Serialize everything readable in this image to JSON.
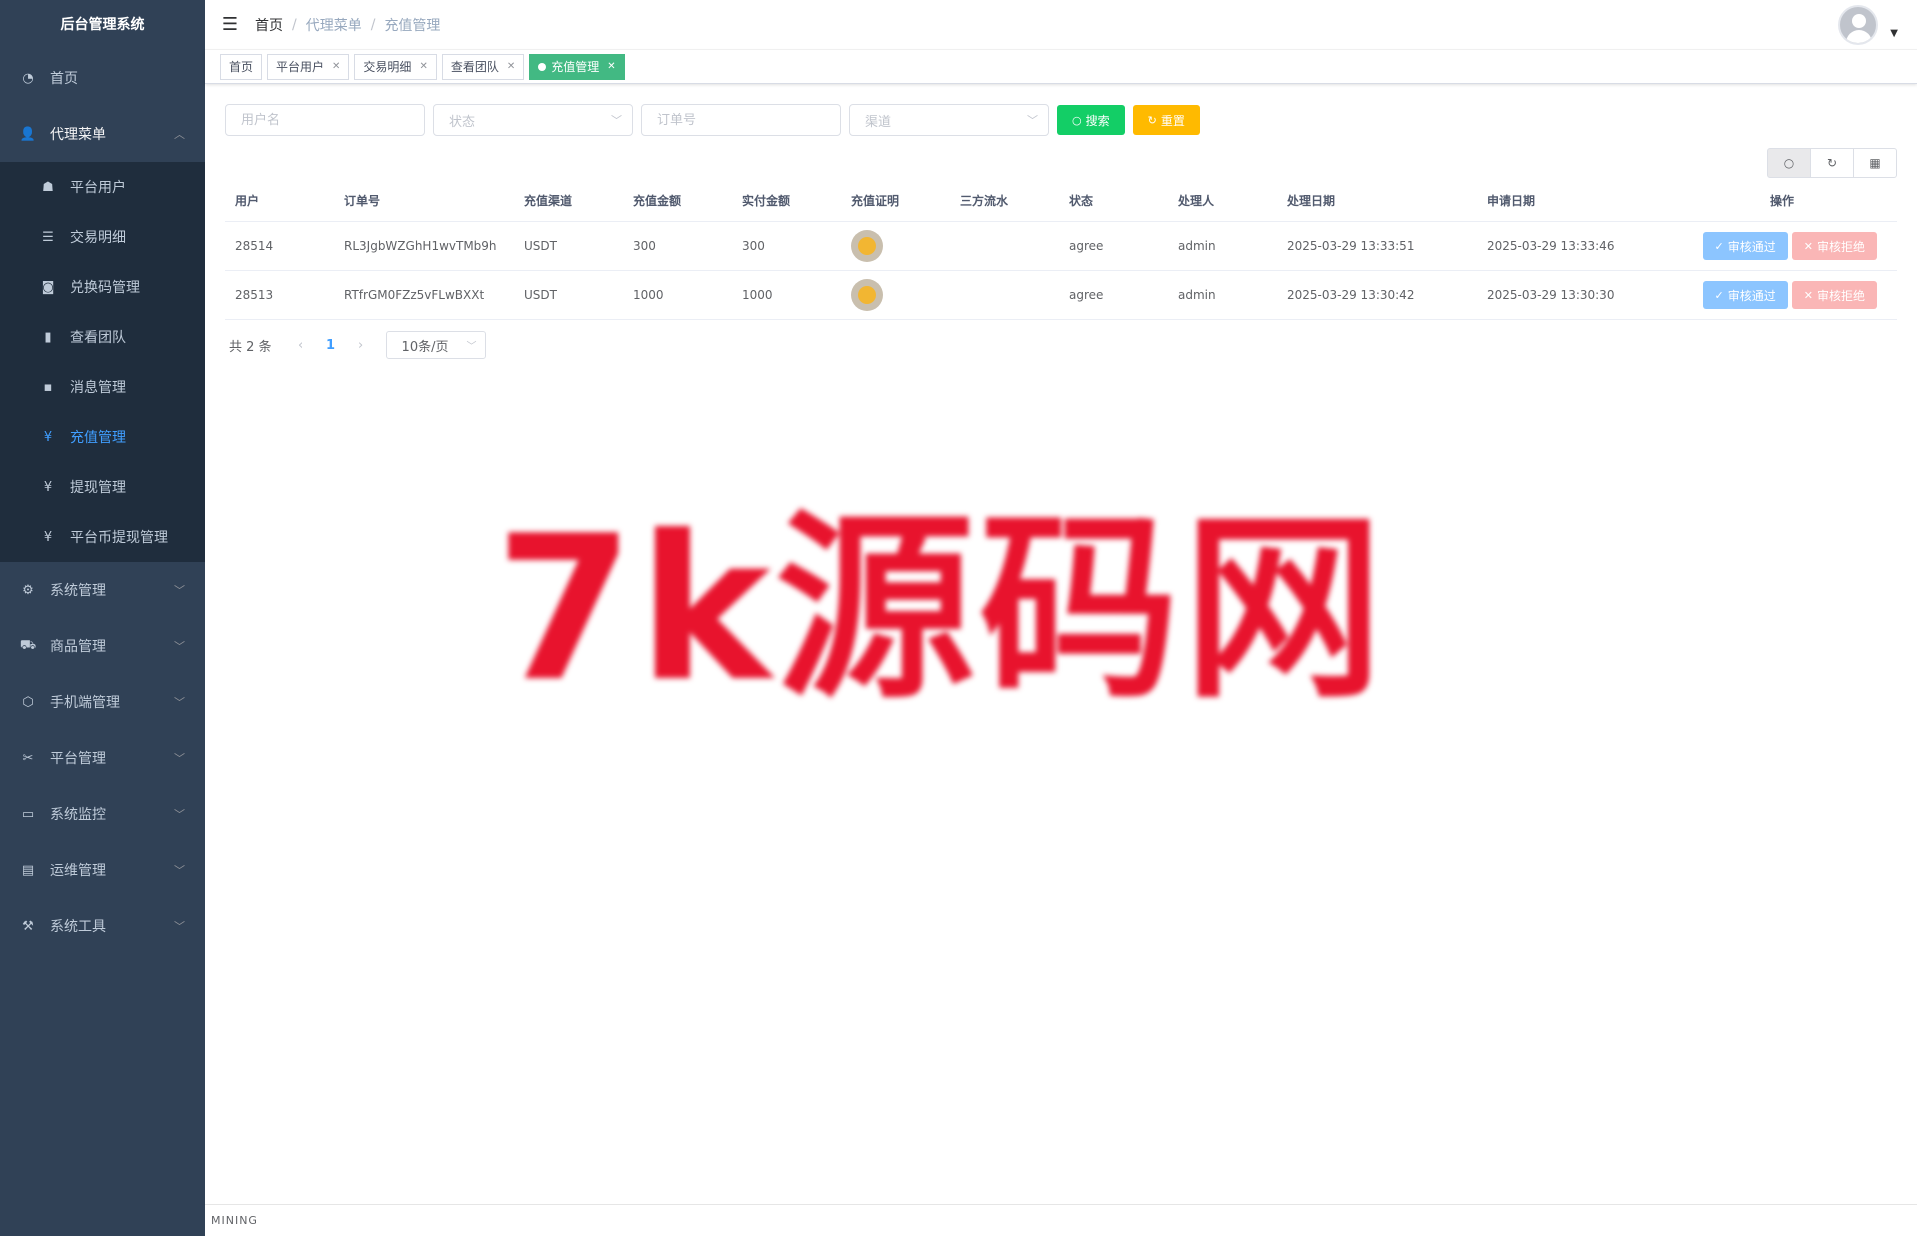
{
  "sidebar": {
    "logo": "后台管理系统",
    "home": {
      "label": "首页"
    },
    "agent_menu": {
      "label": "代理菜单",
      "items": [
        {
          "label": "平台用户"
        },
        {
          "label": "交易明细"
        },
        {
          "label": "兑换码管理"
        },
        {
          "label": "查看团队"
        },
        {
          "label": "消息管理"
        },
        {
          "label": "充值管理"
        },
        {
          "label": "提现管理"
        },
        {
          "label": "平台币提现管理"
        }
      ]
    },
    "groups": [
      {
        "label": "系统管理"
      },
      {
        "label": "商品管理"
      },
      {
        "label": "手机端管理"
      },
      {
        "label": "平台管理"
      },
      {
        "label": "系统监控"
      },
      {
        "label": "运维管理"
      },
      {
        "label": "系统工具"
      }
    ]
  },
  "navbar": {
    "breadcrumb": [
      "首页",
      "代理菜单",
      "充值管理"
    ],
    "sep": "/"
  },
  "tags": [
    {
      "label": "首页"
    },
    {
      "label": "平台用户"
    },
    {
      "label": "交易明细"
    },
    {
      "label": "查看团队"
    },
    {
      "label": "充值管理"
    }
  ],
  "search": {
    "username_placeholder": "用户名",
    "status_placeholder": "状态",
    "order_placeholder": "订单号",
    "channel_placeholder": "渠道",
    "search_label": "搜索",
    "reset_label": "重置"
  },
  "table": {
    "headers": [
      "用户",
      "订单号",
      "充值渠道",
      "充值金额",
      "实付金额",
      "充值证明",
      "三方流水",
      "状态",
      "处理人",
      "处理日期",
      "申请日期",
      "操作"
    ],
    "rows": [
      {
        "user": "28514",
        "order": "RL3JgbWZGhH1wvTMb9h",
        "channel": "USDT",
        "amount": "300",
        "paid": "300",
        "flow": "",
        "status": "agree",
        "handler": "admin",
        "handled_at": "2025-03-29 13:33:51",
        "applied_at": "2025-03-29 13:33:46"
      },
      {
        "user": "28513",
        "order": "RTfrGM0FZz5vFLwBXXt",
        "channel": "USDT",
        "amount": "1000",
        "paid": "1000",
        "flow": "",
        "status": "agree",
        "handler": "admin",
        "handled_at": "2025-03-29 13:30:42",
        "applied_at": "2025-03-29 13:30:30"
      }
    ],
    "approve_label": "审核通过",
    "reject_label": "审核拒绝"
  },
  "pagination": {
    "total": "共 2 条",
    "current_page": "1",
    "page_size": "10条/页"
  },
  "watermark": "7k源码网",
  "footer": "MINING",
  "colors": {
    "sidebar_bg": "#304156",
    "submenu_bg": "#1f2d3d",
    "active_link": "#409eff",
    "active_tag": "#42b983",
    "search_btn": "#13ce66",
    "reset_btn": "#ffba00",
    "approve_btn": "#8cc5ff",
    "reject_btn": "#fab6b6",
    "watermark": "#e8132d"
  }
}
